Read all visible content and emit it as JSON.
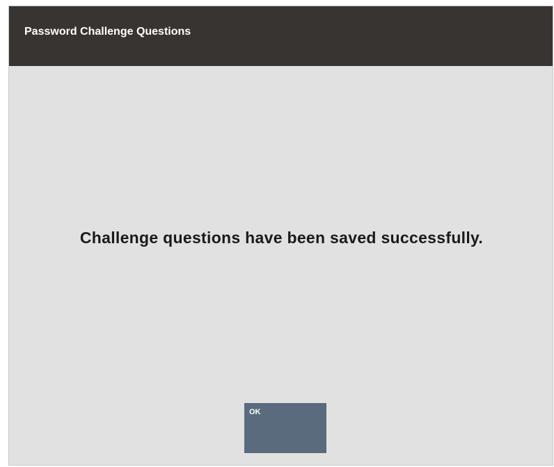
{
  "dialog": {
    "title": "Password Challenge Questions",
    "message": "Challenge questions have been saved successfully.",
    "ok_label": "OK"
  },
  "colors": {
    "titlebar": "#383431",
    "background": "#e1e1e1",
    "button": "#5a6b7e"
  }
}
